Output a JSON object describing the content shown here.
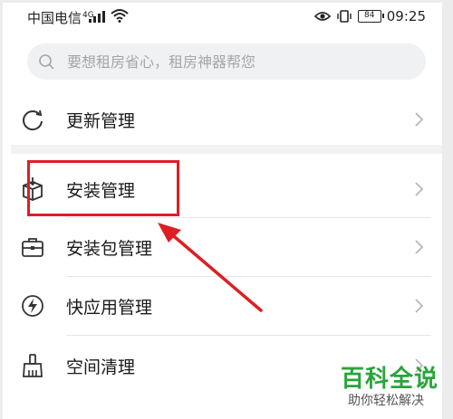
{
  "status_bar": {
    "carrier": "中国电信",
    "network": "4G",
    "battery": "84",
    "time": "09:25"
  },
  "search": {
    "placeholder": "要想租房省心，租房神器帮您",
    "value": ""
  },
  "menu": {
    "items": [
      {
        "label": "更新管理",
        "icon": "refresh-icon"
      },
      {
        "label": "安装管理",
        "icon": "install-box-icon"
      },
      {
        "label": "安装包管理",
        "icon": "package-briefcase-icon"
      },
      {
        "label": "快应用管理",
        "icon": "lightning-icon"
      },
      {
        "label": "空间清理",
        "icon": "broom-icon"
      }
    ]
  },
  "annotation": {
    "highlight_color": "#dd1f24",
    "highlighted_item": "安装管理"
  },
  "watermark": {
    "title": "百科全说",
    "subtitle": "助你轻松解决",
    "color": "#2aa43b"
  }
}
